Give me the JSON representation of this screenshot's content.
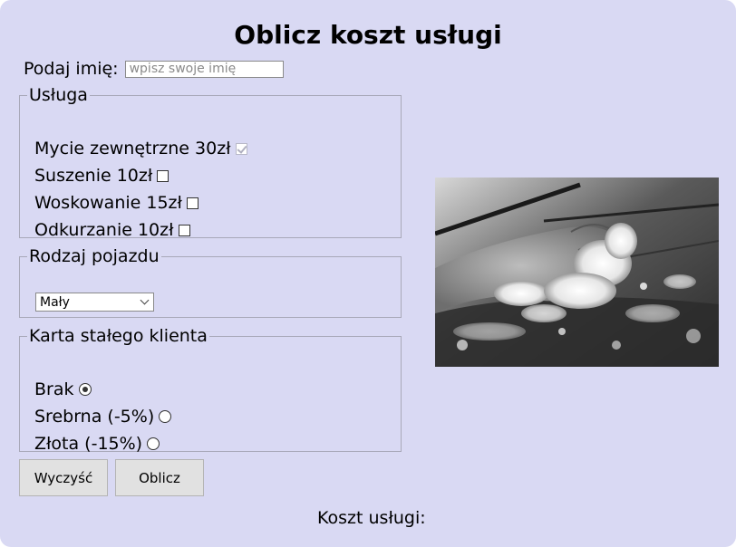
{
  "title": "Oblicz koszt usługi",
  "name_field": {
    "label": "Podaj imię:",
    "placeholder": "wpisz swoje imię",
    "value": ""
  },
  "services": {
    "legend": "Usługa",
    "items": [
      {
        "label": "Mycie zewnętrzne 30zł",
        "checked": true,
        "disabled": true
      },
      {
        "label": "Suszenie 10zł",
        "checked": false,
        "disabled": false
      },
      {
        "label": "Woskowanie 15zł",
        "checked": false,
        "disabled": false
      },
      {
        "label": "Odkurzanie 10zł",
        "checked": false,
        "disabled": false
      }
    ]
  },
  "vehicle": {
    "legend": "Rodzaj pojazdu",
    "selected": "Mały"
  },
  "loyalty": {
    "legend": "Karta stałego klienta",
    "items": [
      {
        "label": "Brak",
        "checked": true
      },
      {
        "label": "Srebrna (-5%)",
        "checked": false
      },
      {
        "label": "Złota (-15%)",
        "checked": false
      }
    ]
  },
  "buttons": {
    "clear": "Wyczyść",
    "calculate": "Oblicz"
  },
  "result": {
    "label": "Koszt usługi:",
    "value": ""
  }
}
